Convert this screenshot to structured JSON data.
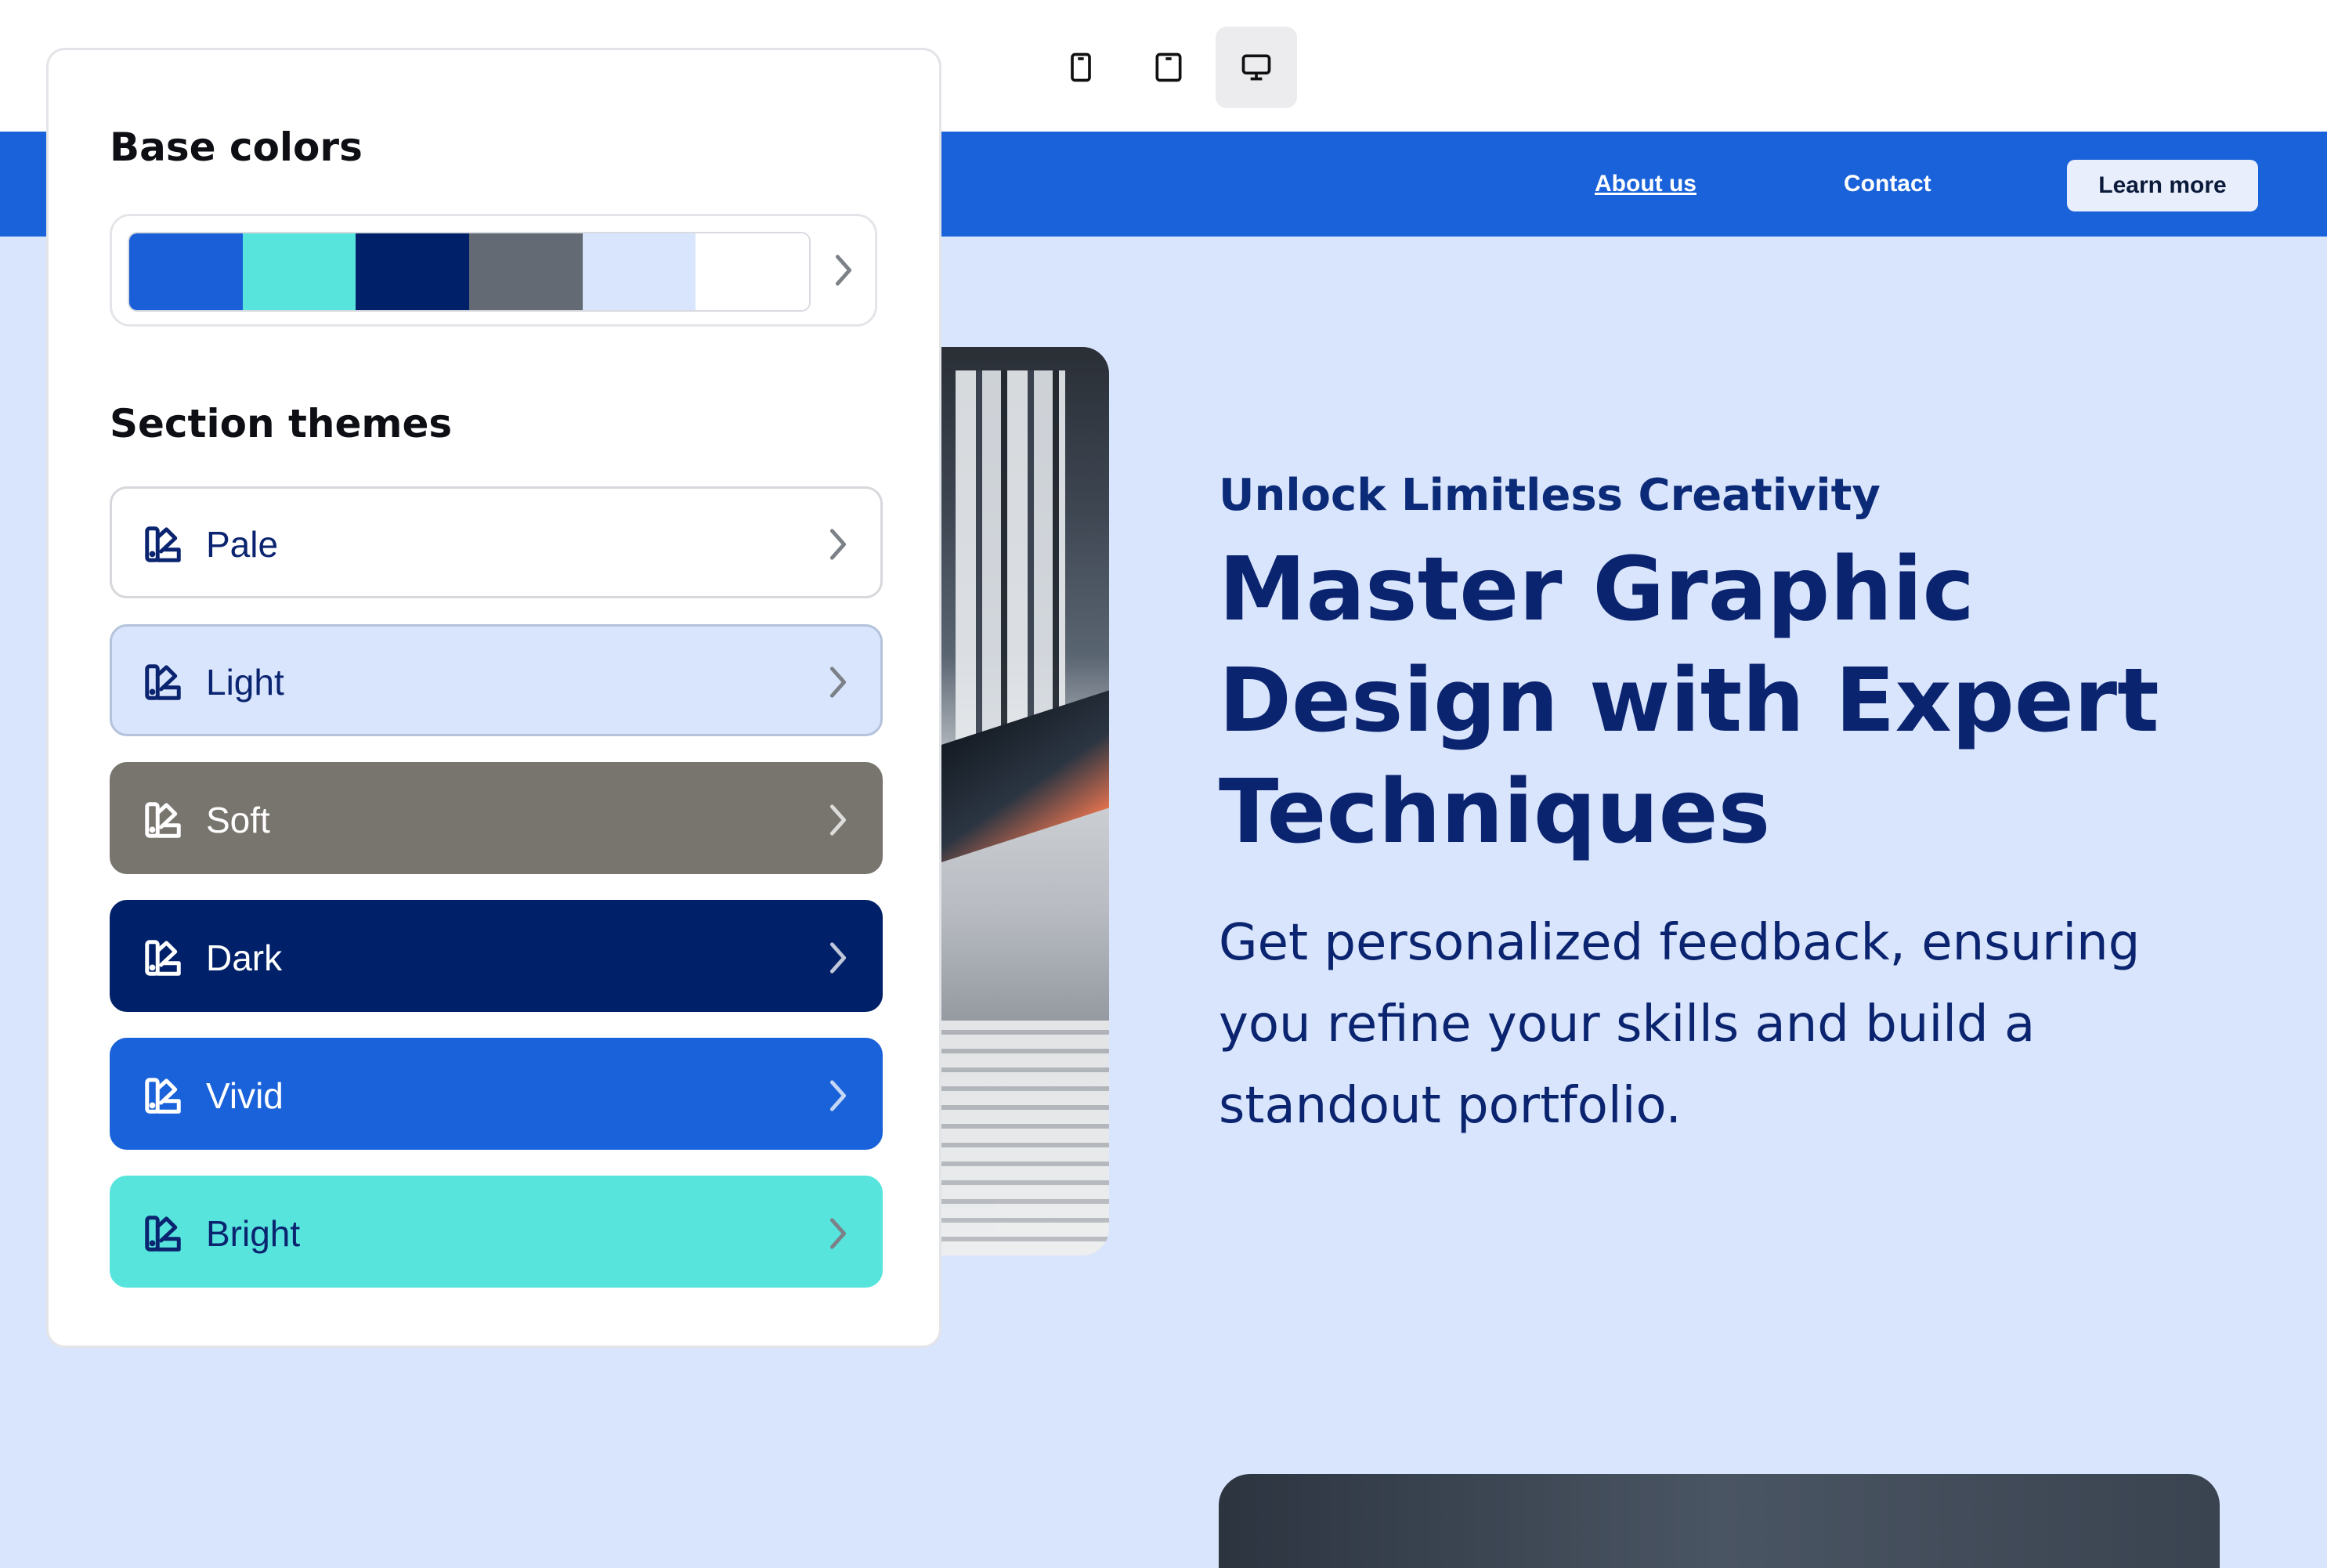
{
  "toolbar": {
    "devices": [
      {
        "name": "mobile",
        "icon": "phone-icon",
        "active": false
      },
      {
        "name": "tablet",
        "icon": "tablet-icon",
        "active": false
      },
      {
        "name": "desktop",
        "icon": "desktop-icon",
        "active": true
      }
    ]
  },
  "nav": {
    "links": [
      "About us",
      "Contact"
    ],
    "cta": "Learn more"
  },
  "hero": {
    "eyebrow": "Unlock Limitless Creativity",
    "title": "Master Graphic Design with Expert Techniques",
    "body": "Get personalized feedback, ensuring you refine your skills and build a standout portfolio."
  },
  "panel": {
    "base_colors_heading": "Base colors",
    "base_colors": [
      "#1a5fd8",
      "#57e4dc",
      "#002169",
      "#646a74",
      "#d8e5fc",
      "#ffffff"
    ],
    "section_themes_heading": "Section themes",
    "themes": [
      {
        "label": "Pale",
        "bg": "#ffffff",
        "fg": "#0b2470",
        "border": "#d6d8dc"
      },
      {
        "label": "Light",
        "bg": "#d9e5fc",
        "fg": "#0b2470",
        "border": "#b4c2dc"
      },
      {
        "label": "Soft",
        "bg": "#78746e",
        "fg": "#ffffff",
        "border": "#78746e"
      },
      {
        "label": "Dark",
        "bg": "#002169",
        "fg": "#ffffff",
        "border": "#002169"
      },
      {
        "label": "Vivid",
        "bg": "#1a62d9",
        "fg": "#ffffff",
        "border": "#1a62d9"
      },
      {
        "label": "Bright",
        "bg": "#57e4dc",
        "fg": "#0b2470",
        "border": "#57e4dc"
      }
    ]
  }
}
